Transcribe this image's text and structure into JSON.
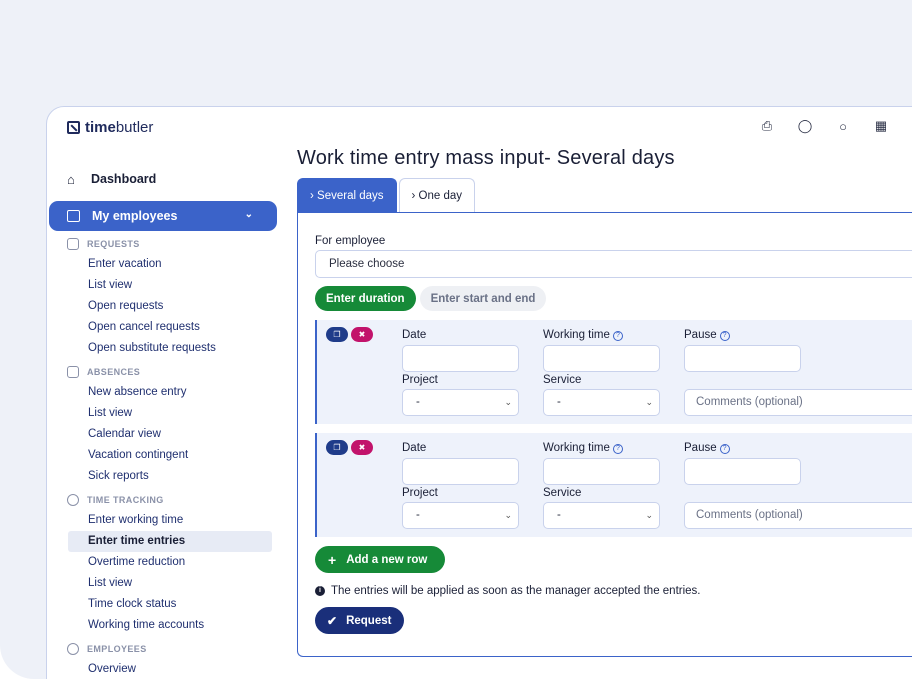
{
  "app": {
    "logo_bold": "time",
    "logo_rest": "butler"
  },
  "topbar": {
    "icons": [
      "printer-icon",
      "bug-icon",
      "globe-icon",
      "calendar-icon"
    ]
  },
  "sidebar": {
    "dashboard": "Dashboard",
    "my_employees": "My employees",
    "sections": [
      {
        "title": "REQUESTS",
        "items": [
          "Enter vacation",
          "List view",
          "Open requests",
          "Open cancel requests",
          "Open substitute requests"
        ]
      },
      {
        "title": "ABSENCES",
        "items": [
          "New absence entry",
          "List view",
          "Calendar view",
          "Vacation contingent",
          "Sick reports"
        ]
      },
      {
        "title": "TIME TRACKING",
        "items": [
          "Enter working time",
          "Enter time entries",
          "Overtime reduction",
          "List view",
          "Time clock status",
          "Working time accounts"
        ]
      },
      {
        "title": "EMPLOYEES",
        "items": [
          "Overview"
        ]
      }
    ],
    "active_item": "Enter time entries"
  },
  "main": {
    "title": "Work time entry mass input- Several days",
    "tabs": [
      {
        "label": "› Several days",
        "active": true
      },
      {
        "label": "› One day",
        "active": false
      }
    ],
    "employee_label": "For employee",
    "employee_placeholder": "Please choose",
    "mode_pills": [
      {
        "label": "Enter duration",
        "active": true
      },
      {
        "label": "Enter start and end",
        "active": false
      }
    ],
    "row_labels": {
      "date": "Date",
      "working_time": "Working time",
      "pause": "Pause",
      "project": "Project",
      "service": "Service",
      "project_value": "-",
      "service_value": "-",
      "comments_placeholder": "Comments (optional)"
    },
    "add_row": "Add a new row",
    "info_text": "The entries will be applied as soon as the manager accepted the entries.",
    "request_button": "Request"
  },
  "colors": {
    "primary": "#3b63c9",
    "green": "#168a38",
    "navy": "#1a2f7a",
    "delete": "#c2136b"
  }
}
